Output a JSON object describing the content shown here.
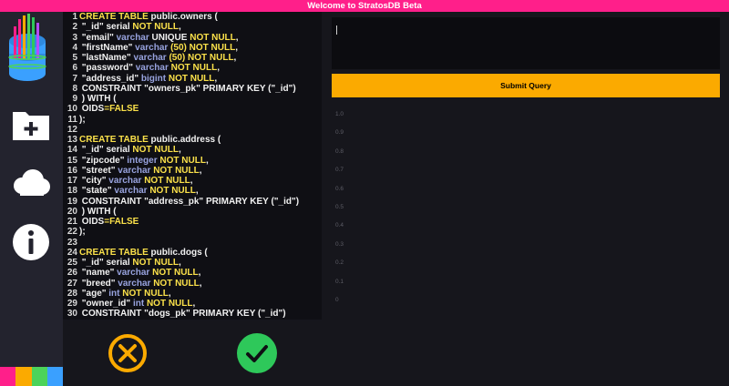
{
  "app": {
    "title": "Welcome to StratosDB Beta"
  },
  "sidebar": {
    "logo": "stratosdb-logo",
    "buttons": [
      {
        "name": "new-folder-button",
        "icon": "folder-plus-icon"
      },
      {
        "name": "cloud-button",
        "icon": "cloud-icon"
      },
      {
        "name": "info-button",
        "icon": "info-icon"
      }
    ],
    "stripe_colors": [
      "#ff1f8a",
      "#fbaa00",
      "#4cd35a",
      "#3aa0ff"
    ]
  },
  "editor": {
    "lines": [
      [
        [
          "kw",
          "CREATE TABLE "
        ],
        [
          "c",
          "public.owners ("
        ]
      ],
      [
        [
          "c",
          " \"_id\" serial "
        ],
        [
          "kw",
          "NOT NULL"
        ],
        [
          "c",
          ","
        ]
      ],
      [
        [
          "c",
          " \"email\" "
        ],
        [
          "ty",
          "varchar "
        ],
        [
          "c",
          "UNIQUE "
        ],
        [
          "kw",
          "NOT NULL"
        ],
        [
          "c",
          ","
        ]
      ],
      [
        [
          "c",
          " \"firstName\" "
        ],
        [
          "ty",
          "varchar "
        ],
        [
          "kw",
          "(50) NOT NULL"
        ],
        [
          "c",
          ","
        ]
      ],
      [
        [
          "c",
          " \"lastName\" "
        ],
        [
          "ty",
          "varchar "
        ],
        [
          "kw",
          "(50) NOT NULL"
        ],
        [
          "c",
          ","
        ]
      ],
      [
        [
          "c",
          " \"password\" "
        ],
        [
          "ty",
          "varchar "
        ],
        [
          "kw",
          "NOT NULL"
        ],
        [
          "c",
          ","
        ]
      ],
      [
        [
          "c",
          " \"address_id\" "
        ],
        [
          "ty",
          "bigint "
        ],
        [
          "kw",
          "NOT NULL"
        ],
        [
          "c",
          ","
        ]
      ],
      [
        [
          "c",
          " CONSTRAINT \"owners_pk\" PRIMARY KEY (\"_id\")"
        ]
      ],
      [
        [
          "c",
          " ) WITH ("
        ]
      ],
      [
        [
          "c",
          " OIDS"
        ],
        [
          "kw",
          "=FALSE"
        ]
      ],
      [
        [
          "c",
          ");"
        ]
      ],
      [
        [
          "c",
          ""
        ]
      ],
      [
        [
          "kw",
          "CREATE TABLE "
        ],
        [
          "c",
          "public.address ("
        ]
      ],
      [
        [
          "c",
          " \"_id\" serial "
        ],
        [
          "kw",
          "NOT NULL"
        ],
        [
          "c",
          ","
        ]
      ],
      [
        [
          "c",
          " \"zipcode\" "
        ],
        [
          "ty",
          "integer "
        ],
        [
          "kw",
          "NOT NULL"
        ],
        [
          "c",
          ","
        ]
      ],
      [
        [
          "c",
          " \"street\" "
        ],
        [
          "ty",
          "varchar "
        ],
        [
          "kw",
          "NOT NULL"
        ],
        [
          "c",
          ","
        ]
      ],
      [
        [
          "c",
          " \"city\" "
        ],
        [
          "ty",
          "varchar "
        ],
        [
          "kw",
          "NOT NULL"
        ],
        [
          "c",
          ","
        ]
      ],
      [
        [
          "c",
          " \"state\" "
        ],
        [
          "ty",
          "varchar "
        ],
        [
          "kw",
          "NOT NULL"
        ],
        [
          "c",
          ","
        ]
      ],
      [
        [
          "c",
          " CONSTRAINT \"address_pk\" PRIMARY KEY (\"_id\")"
        ]
      ],
      [
        [
          "c",
          " ) WITH ("
        ]
      ],
      [
        [
          "c",
          " OIDS"
        ],
        [
          "kw",
          "=FALSE"
        ]
      ],
      [
        [
          "c",
          ");"
        ]
      ],
      [
        [
          "c",
          ""
        ]
      ],
      [
        [
          "kw",
          "CREATE TABLE "
        ],
        [
          "c",
          "public.dogs ("
        ]
      ],
      [
        [
          "c",
          " \"_id\" serial "
        ],
        [
          "kw",
          "NOT NULL"
        ],
        [
          "c",
          ","
        ]
      ],
      [
        [
          "c",
          " \"name\" "
        ],
        [
          "ty",
          "varchar "
        ],
        [
          "kw",
          "NOT NULL"
        ],
        [
          "c",
          ","
        ]
      ],
      [
        [
          "c",
          " \"breed\" "
        ],
        [
          "ty",
          "varchar "
        ],
        [
          "kw",
          "NOT NULL"
        ],
        [
          "c",
          ","
        ]
      ],
      [
        [
          "c",
          " \"age\" "
        ],
        [
          "ty",
          "int "
        ],
        [
          "kw",
          "NOT NULL"
        ],
        [
          "c",
          ","
        ]
      ],
      [
        [
          "c",
          " \"owner_id\" "
        ],
        [
          "ty",
          "int "
        ],
        [
          "kw",
          "NOT NULL"
        ],
        [
          "c",
          ","
        ]
      ],
      [
        [
          "c",
          " CONSTRAINT \"dogs_pk\" PRIMARY KEY (\"_id\")"
        ]
      ]
    ]
  },
  "query": {
    "value": "",
    "submit_label": "Submit Query"
  },
  "chart": {
    "y_ticks": [
      "1.0",
      "0.9",
      "0.8",
      "0.7",
      "0.6",
      "0.5",
      "0.4",
      "0.3",
      "0.2",
      "0.1",
      "0"
    ]
  },
  "actions": {
    "cancel": {
      "icon": "x-circle-icon",
      "color": "#fbaa00"
    },
    "confirm": {
      "icon": "check-icon",
      "color": "#2ec85a"
    }
  }
}
